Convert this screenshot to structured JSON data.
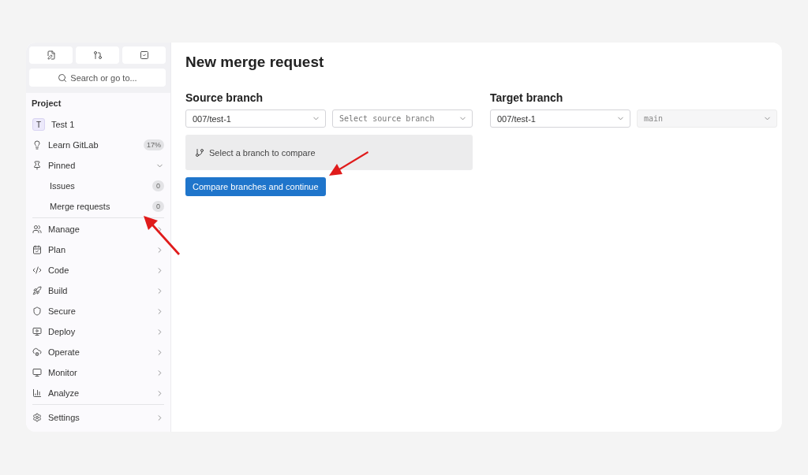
{
  "sidebar": {
    "search": {
      "placeholder": "Search or go to..."
    },
    "section_title": "Project",
    "project": {
      "avatar": "T",
      "name": "Test 1"
    },
    "items": [
      {
        "label": "Learn GitLab",
        "badge": "17%"
      },
      {
        "label": "Pinned",
        "expanded": true,
        "children": [
          {
            "label": "Issues",
            "badge": "0"
          },
          {
            "label": "Merge requests",
            "badge": "0"
          }
        ]
      }
    ],
    "menu": [
      {
        "label": "Manage"
      },
      {
        "label": "Plan"
      },
      {
        "label": "Code"
      },
      {
        "label": "Build"
      },
      {
        "label": "Secure"
      },
      {
        "label": "Deploy"
      },
      {
        "label": "Operate"
      },
      {
        "label": "Monitor"
      },
      {
        "label": "Analyze"
      }
    ],
    "settings": {
      "label": "Settings"
    }
  },
  "main": {
    "title": "New merge request",
    "source": {
      "heading": "Source branch",
      "project": {
        "value": "007/test-1",
        "disabled": false
      },
      "branch": {
        "placeholder": "Select source branch",
        "disabled": false
      },
      "notice": "Select a branch to compare",
      "button": "Compare branches and continue"
    },
    "target": {
      "heading": "Target branch",
      "project": {
        "value": "007/test-1",
        "disabled": false
      },
      "branch": {
        "value": "main",
        "disabled": true
      }
    }
  }
}
